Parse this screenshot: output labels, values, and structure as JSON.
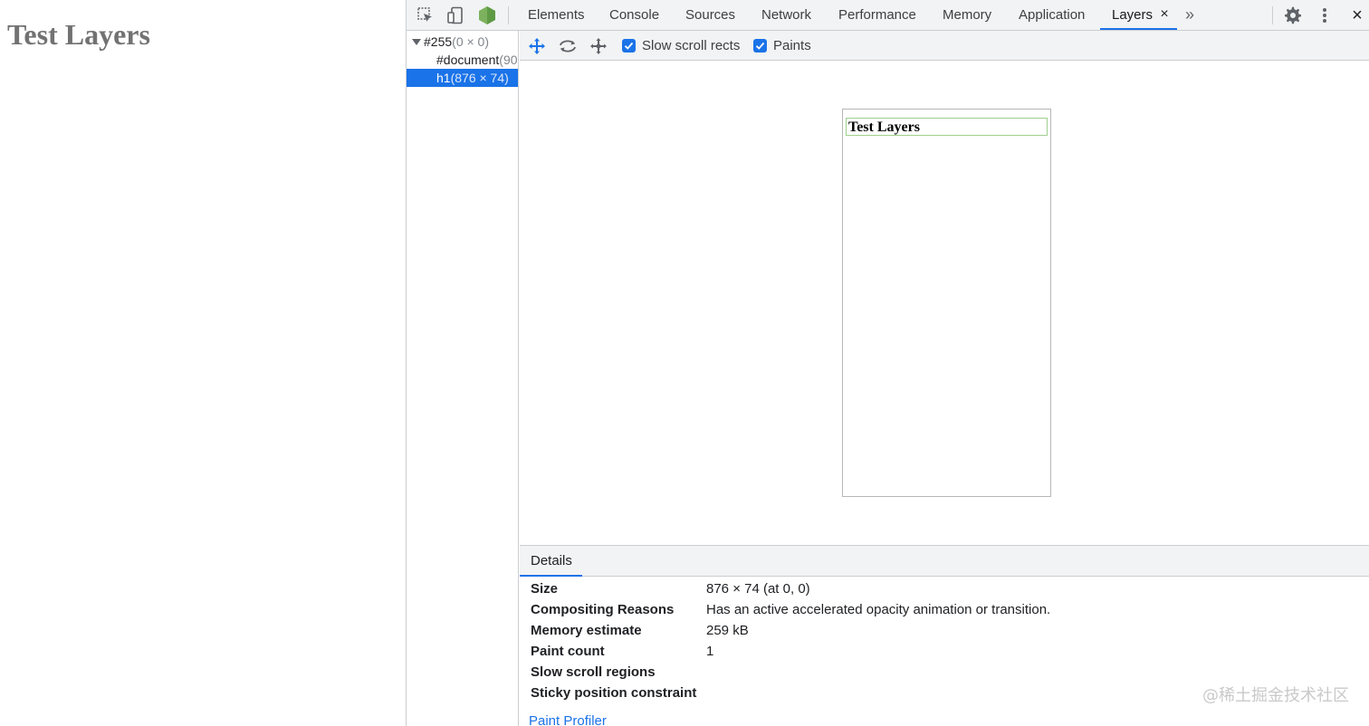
{
  "page": {
    "heading": "Test Layers"
  },
  "devtools": {
    "toolbar_icons": [
      "inspect-element-icon",
      "device-toolbar-icon",
      "node-extension-icon"
    ],
    "tabs": [
      {
        "label": "Elements"
      },
      {
        "label": "Console"
      },
      {
        "label": "Sources"
      },
      {
        "label": "Network"
      },
      {
        "label": "Performance"
      },
      {
        "label": "Memory"
      },
      {
        "label": "Application"
      },
      {
        "label": "Layers",
        "active": true
      }
    ],
    "more_tabs_glyph": "»",
    "close_glyph": "×",
    "settings_icon": "gear-icon",
    "menu_icon": "kebab-menu-icon",
    "accent_color": "#1a73e8"
  },
  "layer_tree": {
    "rows": [
      {
        "name": "#255",
        "size": "(0 × 0)",
        "expanded": true
      },
      {
        "name": "#document",
        "size": "(90"
      },
      {
        "name": "h1",
        "size": "(876 × 74)",
        "selected": true
      }
    ]
  },
  "layers_toolbar": {
    "tool_icons": [
      "pan-mode-icon",
      "rotate-mode-icon",
      "reset-transform-icon"
    ],
    "checkboxes": [
      {
        "label": "Slow scroll rects",
        "checked": true
      },
      {
        "label": "Paints",
        "checked": true
      }
    ]
  },
  "viewport": {
    "layer_label": "Test Layers"
  },
  "details": {
    "tab": "Details",
    "rows": [
      {
        "label": "Size",
        "value": "876 × 74 (at 0, 0)"
      },
      {
        "label": "Compositing Reasons",
        "value": "Has an active accelerated opacity animation or transition."
      },
      {
        "label": "Memory estimate",
        "value": "259 kB"
      },
      {
        "label": "Paint count",
        "value": "1"
      },
      {
        "label": "Slow scroll regions",
        "value": ""
      },
      {
        "label": "Sticky position constraint",
        "value": ""
      }
    ],
    "link": "Paint Profiler"
  },
  "watermark": "@稀土掘金技术社区"
}
